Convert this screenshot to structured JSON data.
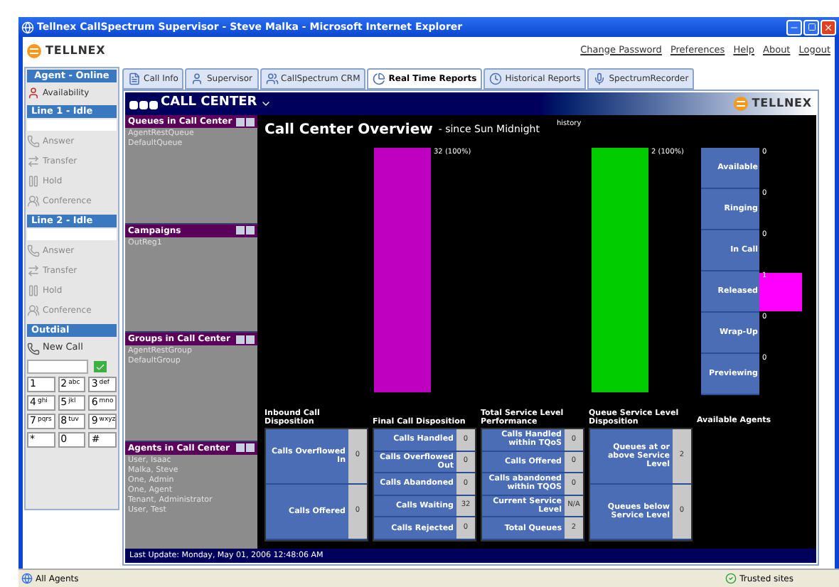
{
  "window": {
    "title": "Tellnex CallSpectrum Supervisor - Steve Malka - Microsoft Internet Explorer"
  },
  "header": {
    "logo": "TELLNEX",
    "links": [
      "Change Password",
      "Preferences",
      "Help",
      "About",
      "Logout"
    ]
  },
  "sidebar": {
    "agent_title": "Agent - Online",
    "availability": "Availability",
    "lines": [
      {
        "title": "Line 1 - Idle",
        "buttons": [
          {
            "label": "Answer",
            "disabled": true
          },
          {
            "label": "Transfer",
            "disabled": true
          },
          {
            "label": "Hold",
            "disabled": true
          },
          {
            "label": "Conference",
            "disabled": true
          }
        ]
      },
      {
        "title": "Line 2 - Idle",
        "buttons": [
          {
            "label": "Answer",
            "disabled": true
          },
          {
            "label": "Transfer",
            "disabled": true
          },
          {
            "label": "Hold",
            "disabled": true
          },
          {
            "label": "Conference",
            "disabled": true
          }
        ]
      }
    ],
    "outdial": {
      "title": "Outdial",
      "new_call": "New Call",
      "keys": [
        {
          "digit": "1"
        },
        {
          "digit": "2",
          "letters": "abc"
        },
        {
          "digit": "3",
          "letters": "def"
        },
        {
          "digit": "4",
          "letters": "ghi"
        },
        {
          "digit": "5",
          "letters": "jkl"
        },
        {
          "digit": "6",
          "letters": "mno"
        },
        {
          "digit": "7",
          "letters": "pqrs"
        },
        {
          "digit": "8",
          "letters": "tuv"
        },
        {
          "digit": "9",
          "letters": "wxyz"
        },
        {
          "digit": "*"
        },
        {
          "digit": "0"
        },
        {
          "digit": "#"
        }
      ]
    }
  },
  "tabs": [
    {
      "label": "Call Info",
      "selected": false
    },
    {
      "label": "Supervisor",
      "selected": false
    },
    {
      "label": "CallSpectrum CRM",
      "selected": false
    },
    {
      "label": "Real Time Reports",
      "selected": true
    },
    {
      "label": "Historical Reports",
      "selected": false
    },
    {
      "label": "SpectrumRecorder",
      "selected": false
    }
  ],
  "call_center": {
    "title": "CALL CENTER",
    "logo": "TELLNEX",
    "panels": [
      {
        "title": "Queues in Call Center",
        "items": [
          "AgentRestQueue",
          "DefaultQueue"
        ]
      },
      {
        "title": "Campaigns",
        "items": [
          "OutReg1"
        ]
      },
      {
        "title": "Groups in Call Center",
        "items": [
          "AgentRestGroup",
          "DefaultGroup"
        ]
      },
      {
        "title": "Agents in Call Center",
        "items": [
          "User, Isaac",
          "Malka, Steve",
          "One, Admin",
          "One, Agent",
          "Tenant, Administrator",
          "User, Test"
        ]
      }
    ],
    "overview": {
      "title": "Call Center Overview",
      "subtitle": "- since Sun Midnight",
      "history": "history",
      "bars": [
        {
          "label": "32 (100%)",
          "color": "#c000c0"
        },
        {
          "label": "2 (100%)",
          "color": "#00cc00"
        }
      ]
    },
    "agent_states": [
      {
        "label": "Available",
        "count": "0"
      },
      {
        "label": "Ringing",
        "count": "0"
      },
      {
        "label": "In Call",
        "count": "0"
      },
      {
        "label": "Released",
        "count": "1"
      },
      {
        "label": "Wrap-Up",
        "count": "0"
      },
      {
        "label": "Previewing",
        "count": "0"
      }
    ],
    "tables": [
      {
        "title": "Inbound Call Disposition",
        "rows": [
          {
            "label": "Calls Overflowed In",
            "value": "0"
          },
          {
            "label": "Calls Offered",
            "value": "0"
          }
        ]
      },
      {
        "title": "Final Call Disposition",
        "rows": [
          {
            "label": "Calls Handled",
            "value": "0"
          },
          {
            "label": "Calls Overflowed Out",
            "value": "0"
          },
          {
            "label": "Calls Abandoned",
            "value": "0"
          },
          {
            "label": "Calls Waiting",
            "value": "32"
          },
          {
            "label": "Calls Rejected",
            "value": "0"
          }
        ]
      },
      {
        "title": "Total Service Level Performance",
        "rows": [
          {
            "label": "Calls Handled within TQoS",
            "value": "0"
          },
          {
            "label": "Calls Offered",
            "value": "0"
          },
          {
            "label": "Calls abandoned within TQOS",
            "value": "0"
          },
          {
            "label": "Current Service Level",
            "value": "N/A"
          },
          {
            "label": "Total Queues",
            "value": "2"
          }
        ]
      },
      {
        "title": "Queue Service Level Disposition",
        "rows": [
          {
            "label": "Queues at or above Service Level",
            "value": "2"
          },
          {
            "label": "Queues below Service Level",
            "value": "0"
          }
        ]
      }
    ],
    "available_agents": "Available Agents",
    "last_update": "Last Update: Monday, May 01, 2006 12:48:06 AM"
  },
  "status_bar": {
    "left": "All Agents",
    "right": "Trusted sites"
  }
}
